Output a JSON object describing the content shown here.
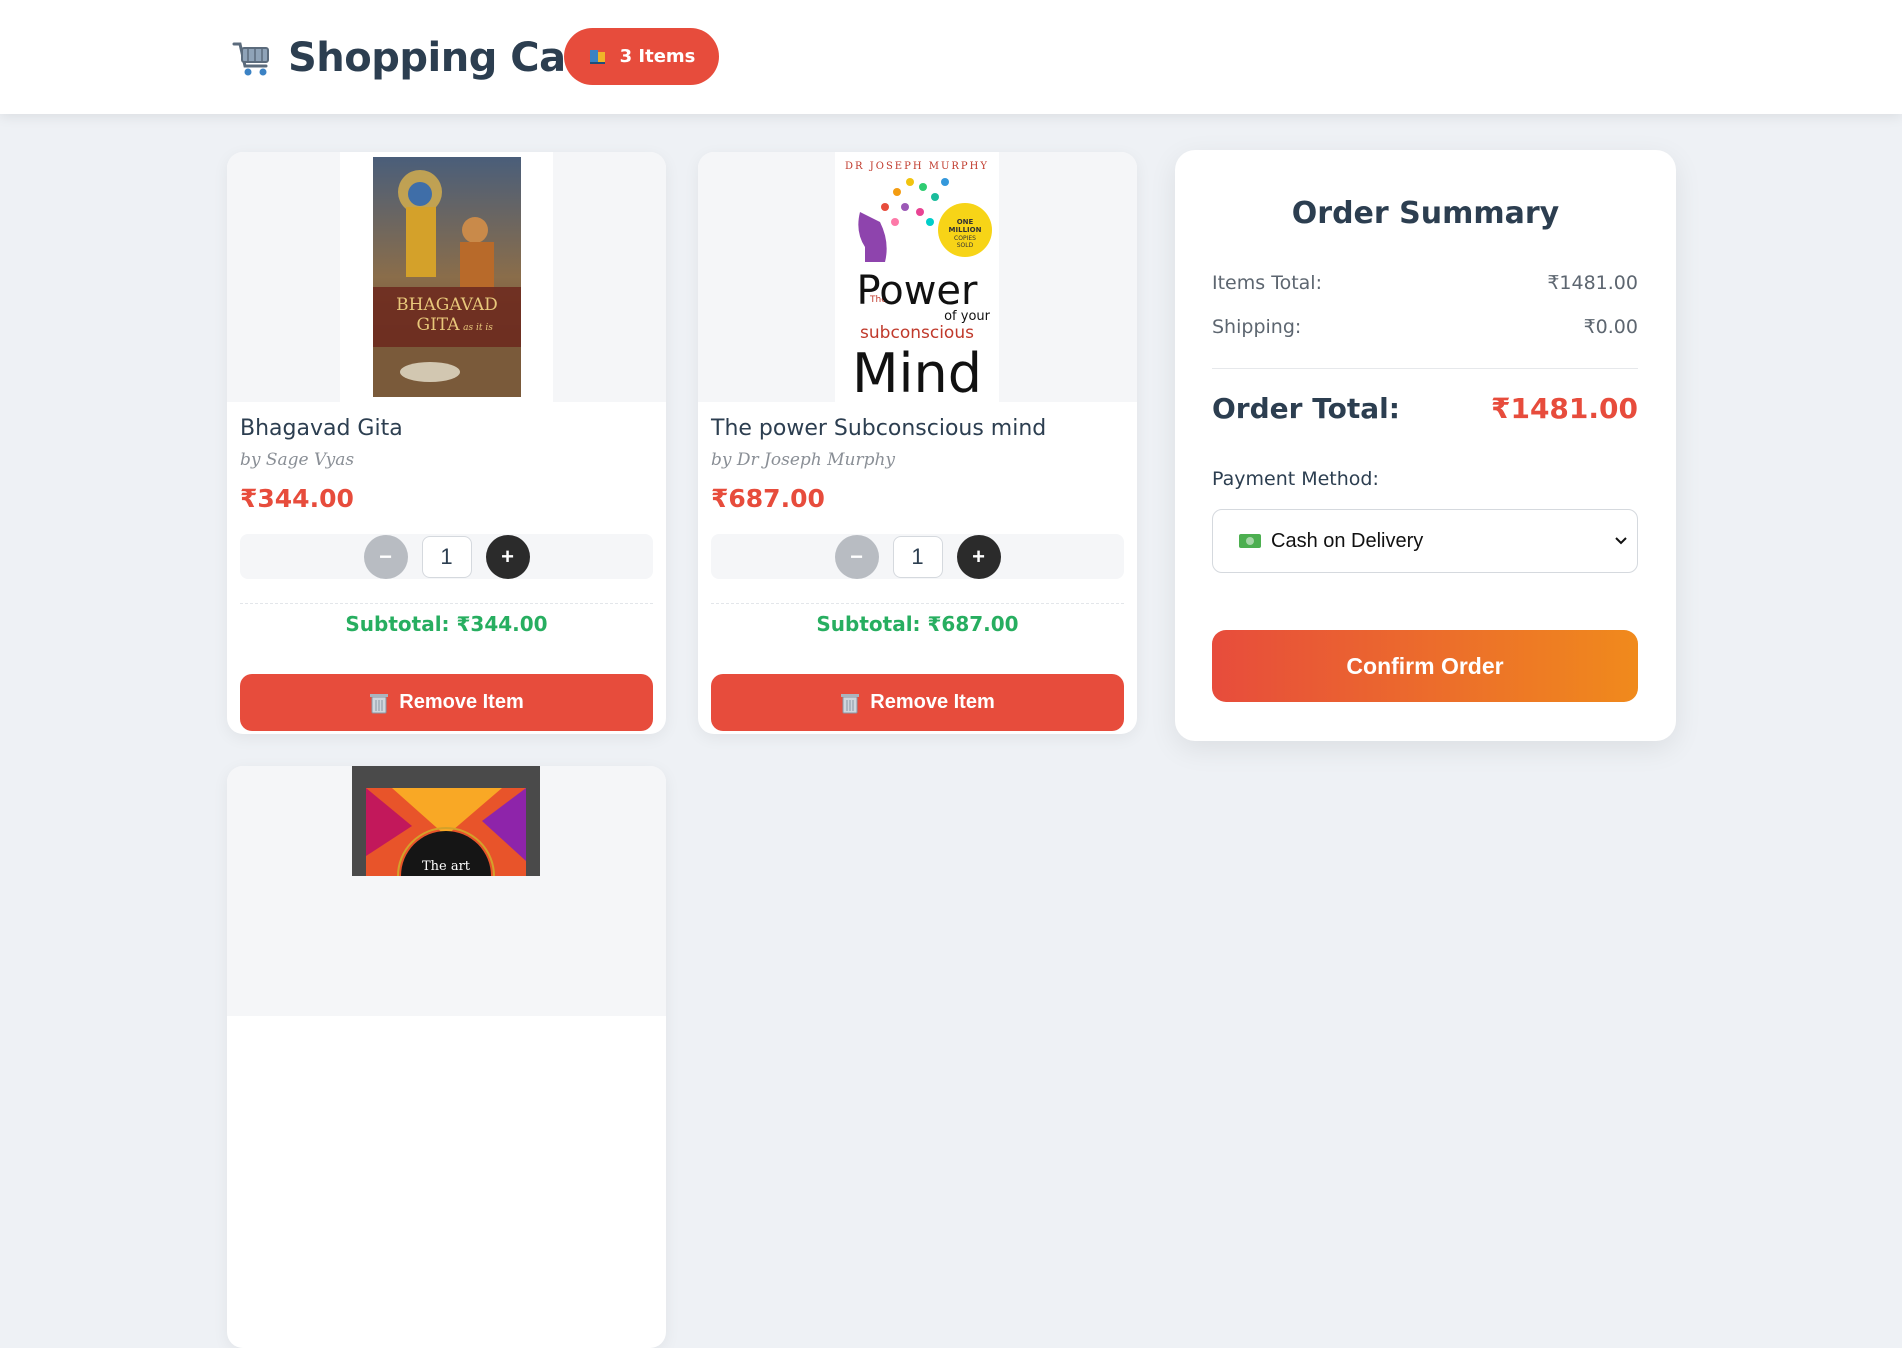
{
  "header": {
    "title": "Shopping Cart",
    "cart_icon": "shopping-cart-icon",
    "badge": "3 Items",
    "badge_icon": "books-icon"
  },
  "cart": {
    "items": [
      {
        "title": "Bhagavad Gita",
        "author": "by Sage Vyas",
        "price": "₹344.00",
        "quantity": "1",
        "subtotal": "Subtotal: ₹344.00",
        "remove_label": "Remove Item",
        "cover": {
          "line1": "BHAGAVAD",
          "line2": "GITA",
          "line3": "as it is"
        }
      },
      {
        "title": "The power Subconscious mind",
        "author": "by Dr Joseph Murphy",
        "price": "₹687.00",
        "quantity": "1",
        "subtotal": "Subtotal: ₹687.00",
        "remove_label": "Remove Item",
        "cover": {
          "author": "DR JOSEPH MURPHY",
          "the": "The",
          "power": "Power",
          "of_your": "of your",
          "sub": "subconscious",
          "mind": "Mind",
          "badge1": "ONE",
          "badge2": "MILLION",
          "badge3": "COPIES",
          "badge4": "SOLD"
        }
      },
      {
        "cover": {
          "text": "The art"
        }
      }
    ],
    "minus_label": "−",
    "plus_label": "+"
  },
  "summary": {
    "title": "Order Summary",
    "items_total_label": "Items Total:",
    "items_total_value": "₹1481.00",
    "shipping_label": "Shipping:",
    "shipping_value": "₹0.00",
    "order_total_label": "Order Total:",
    "order_total_value": "₹1481.00",
    "payment_label": "Payment Method:",
    "payment_selected": "Cash on Delivery",
    "confirm_label": "Confirm Order"
  },
  "colors": {
    "accent": "#e74c3c",
    "success": "#27ae60",
    "gradient_end": "#f08a1c",
    "text": "#2c3e50"
  }
}
